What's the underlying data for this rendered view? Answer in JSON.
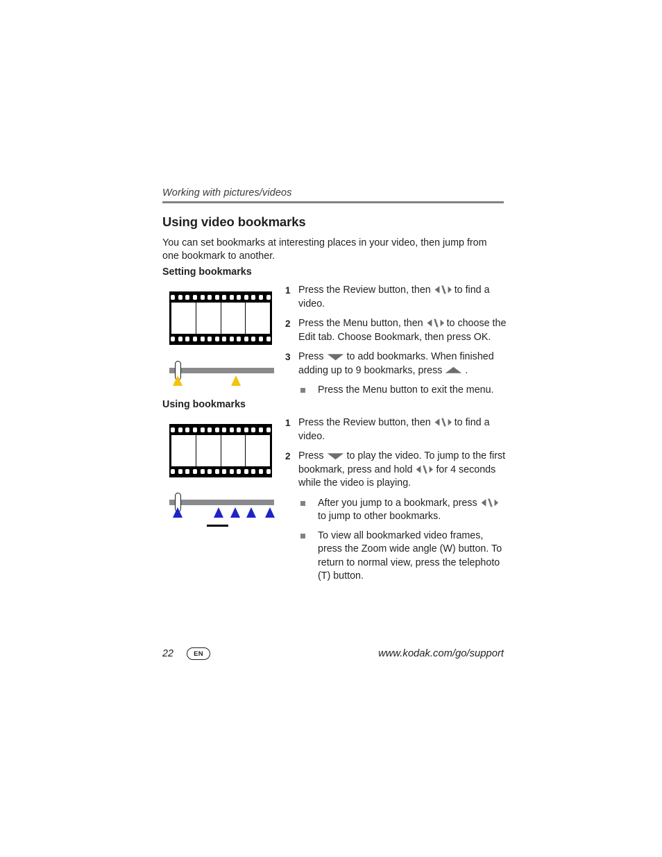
{
  "page": {
    "running_head": "Working with pictures/videos",
    "title": "Using video bookmarks",
    "intro": "You can set bookmarks at interesting places in your video, then jump from one bookmark to another."
  },
  "sections": [
    {
      "heading": "Setting bookmarks",
      "steps": [
        {
          "number": "1",
          "parts": [
            {
              "type": "text",
              "text": "Press the Review button, then "
            },
            {
              "type": "icon",
              "icon": "left-right-arrows-icon"
            },
            {
              "type": "text",
              "text": " to find a video."
            }
          ]
        },
        {
          "number": "2",
          "parts": [
            {
              "type": "text",
              "text": "Press the Menu button, then "
            },
            {
              "type": "icon",
              "icon": "left-right-arrows-icon"
            },
            {
              "type": "text",
              "text": " to choose the Edit tab. Choose Bookmark, then press OK."
            }
          ]
        },
        {
          "number": "3",
          "parts": [
            {
              "type": "text",
              "text": "Press "
            },
            {
              "type": "icon",
              "icon": "down-arrow-icon"
            },
            {
              "type": "text",
              "text": " to add bookmarks. When finished adding up to 9 bookmarks, press "
            },
            {
              "type": "icon",
              "icon": "up-arrow-icon"
            },
            {
              "type": "text",
              "text": " ."
            }
          ]
        }
      ],
      "bullets": [
        {
          "parts": [
            {
              "type": "text",
              "text": "Press the Menu button to exit the menu."
            }
          ]
        }
      ],
      "figure": {
        "filmstrip": {
          "frames": 4,
          "perforations": 14
        },
        "timeline": {
          "playhead_pct": 7,
          "marker_color": "#f5c20c",
          "markers_pct": [
            7,
            63
          ]
        }
      }
    },
    {
      "heading": "Using bookmarks",
      "steps": [
        {
          "number": "1",
          "parts": [
            {
              "type": "text",
              "text": "Press the Review button, then "
            },
            {
              "type": "icon",
              "icon": "left-right-arrows-icon"
            },
            {
              "type": "text",
              "text": " to find a video."
            }
          ]
        },
        {
          "number": "2",
          "parts": [
            {
              "type": "text",
              "text": "Press "
            },
            {
              "type": "icon",
              "icon": "down-arrow-icon"
            },
            {
              "type": "text",
              "text": " to play the video. To jump to the first bookmark, press and hold "
            },
            {
              "type": "icon",
              "icon": "left-right-arrows-icon"
            },
            {
              "type": "text",
              "text": " for 4 seconds while the video is playing."
            }
          ]
        }
      ],
      "bullets": [
        {
          "parts": [
            {
              "type": "text",
              "text": "After you jump to a bookmark, press "
            },
            {
              "type": "icon",
              "icon": "left-right-arrows-icon"
            },
            {
              "type": "text",
              "text": " to jump to other bookmarks."
            }
          ]
        },
        {
          "parts": [
            {
              "type": "text",
              "text": "To view all bookmarked video frames, press the Zoom wide angle (W) button. To return to normal view, press the telephoto (T) button."
            }
          ]
        }
      ],
      "figure": {
        "filmstrip": {
          "frames": 4,
          "perforations": 14
        },
        "timeline": {
          "playhead_pct": 7,
          "marker_color": "#1f23c8",
          "markers_pct": [
            7,
            46,
            62,
            77,
            95
          ],
          "underline_pct": 45
        }
      }
    }
  ],
  "footer": {
    "page_number": "22",
    "language_badge": "EN",
    "support_url": "www.kodak.com/go/support"
  },
  "colors": {
    "rule": "#808285",
    "bullet": "#808285",
    "glyph": "#6d6e71",
    "timeline_bar": "#8a8a8d",
    "marker_yellow": "#f5c20c",
    "marker_blue": "#1f23c8",
    "text": "#231f20"
  }
}
